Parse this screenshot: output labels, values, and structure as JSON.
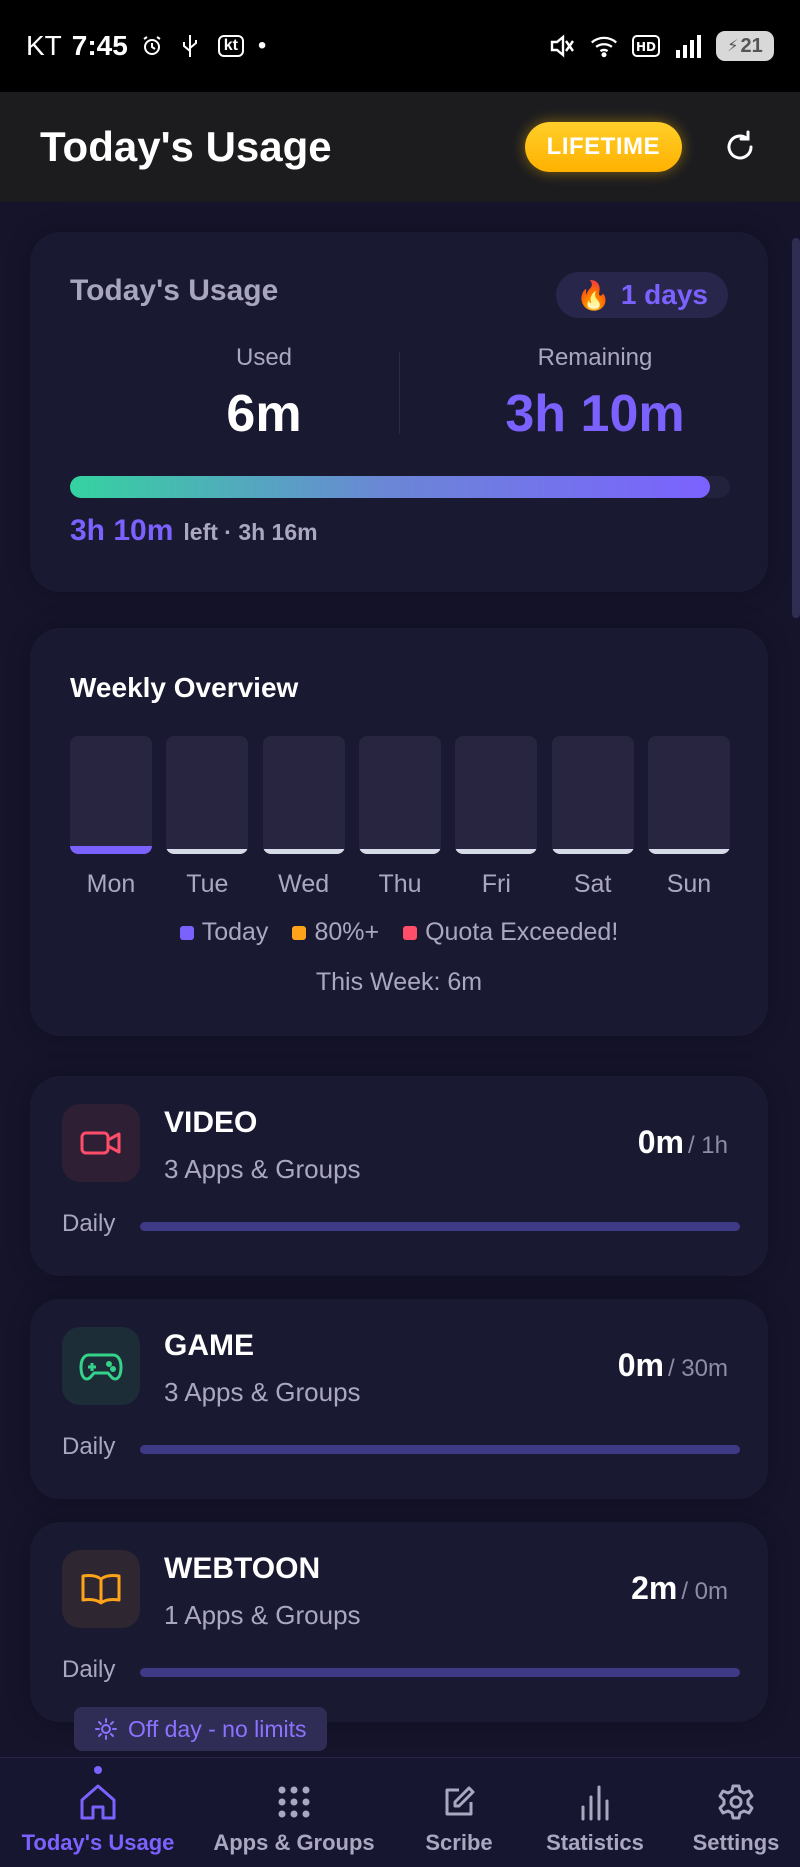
{
  "status_bar": {
    "carrier": "KT",
    "time": "7:45",
    "carrier_badge": "kt",
    "dot": "•",
    "battery": "21"
  },
  "header": {
    "title": "Today's Usage",
    "lifetime_label": "LIFETIME"
  },
  "today_card": {
    "title": "Today's Usage",
    "streak": "1 days",
    "used_label": "Used",
    "used_value": "6m",
    "remaining_label": "Remaining",
    "remaining_value": "3h 10m",
    "progress_fraction": 0.97,
    "left_strong": "3h 10m",
    "left_rest": "left · 3h 16m"
  },
  "weekly": {
    "title": "Weekly Overview",
    "days": [
      "Mon",
      "Tue",
      "Wed",
      "Thu",
      "Fri",
      "Sat",
      "Sun"
    ],
    "legend": [
      "Today",
      "80%+",
      "Quota Exceeded!"
    ],
    "this_week": "This Week: 6m",
    "colors": {
      "today": "#7b62ff",
      "warn": "#ffa31a",
      "exceeded": "#ff4d6a"
    }
  },
  "categories": [
    {
      "name": "VIDEO",
      "sub": "3 Apps & Groups",
      "used": "0m",
      "limit": "/ 1h",
      "period": "Daily",
      "icon": "video-camera-icon",
      "color": "#ff4d6a"
    },
    {
      "name": "GAME",
      "sub": "3 Apps & Groups",
      "used": "0m",
      "limit": "/ 30m",
      "period": "Daily",
      "icon": "gamepad-icon",
      "color": "#35d38a"
    },
    {
      "name": "WEBTOON",
      "sub": "1 Apps & Groups",
      "used": "2m",
      "limit": "/ 0m",
      "period": "Daily",
      "icon": "book-icon",
      "color": "#ffa31a"
    }
  ],
  "offday": "Off day - no limits",
  "nav": [
    {
      "label": "Today's Usage",
      "icon": "home-icon"
    },
    {
      "label": "Apps & Groups",
      "icon": "grid-icon"
    },
    {
      "label": "Scribe",
      "icon": "edit-icon"
    },
    {
      "label": "Statistics",
      "icon": "bar-chart-icon"
    },
    {
      "label": "Settings",
      "icon": "gear-icon"
    }
  ]
}
